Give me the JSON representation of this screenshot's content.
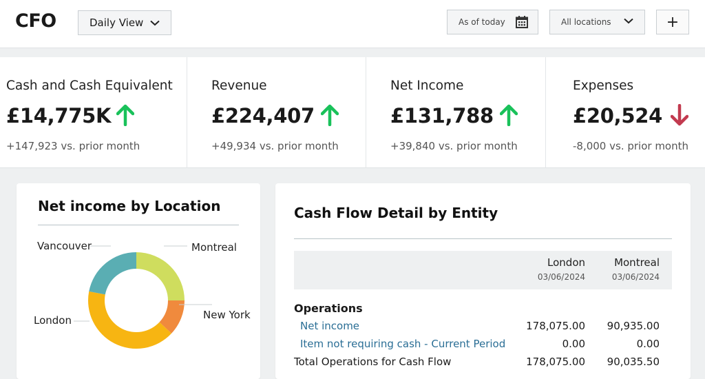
{
  "header": {
    "app_title": "CFO",
    "view_select": "Daily View",
    "date_filter": "As of today",
    "location_filter": "All locations",
    "add_label": "+"
  },
  "kpis": [
    {
      "label": "Cash and Cash Equivalent",
      "value": "£14,775K",
      "trend": "up",
      "delta": "+147,923 vs. prior month"
    },
    {
      "label": "Revenue",
      "value": "£224,407",
      "trend": "up",
      "delta": "+49,934 vs. prior month"
    },
    {
      "label": "Net Income",
      "value": "£131,788",
      "trend": "up",
      "delta": "+39,840 vs. prior month"
    },
    {
      "label": "Expenses",
      "value": "£20,524",
      "trend": "down",
      "delta": "-8,000 vs. prior month"
    }
  ],
  "colors": {
    "up": "#19c15a",
    "down": "#c23a4f",
    "link": "#2a6e95"
  },
  "net_income_card": {
    "title": "Net income by Location",
    "chart_data": {
      "type": "pie",
      "style": "donut",
      "categories": [
        "Montreal",
        "New York",
        "London",
        "Vancouver"
      ],
      "values": [
        25,
        12,
        41,
        22
      ],
      "colors": [
        "#cfdd5e",
        "#f08a3d",
        "#f7b512",
        "#5aaeb3"
      ]
    }
  },
  "cash_flow_card": {
    "title": "Cash Flow Detail by Entity",
    "columns": [
      {
        "name": "London",
        "date": "03/06/2024"
      },
      {
        "name": "Montreal",
        "date": "03/06/2024"
      }
    ],
    "section": "Operations",
    "rows": [
      {
        "label": "Net income",
        "v1": "178,075.00",
        "v2": "90,935.00",
        "link": true
      },
      {
        "label": "Item not requiring cash - Current Period",
        "v1": "0.00",
        "v2": "0.00",
        "link": true
      },
      {
        "label": "Total Operations for Cash Flow",
        "v1": "178,075.00",
        "v2": "90,035.50",
        "link": false
      }
    ]
  }
}
